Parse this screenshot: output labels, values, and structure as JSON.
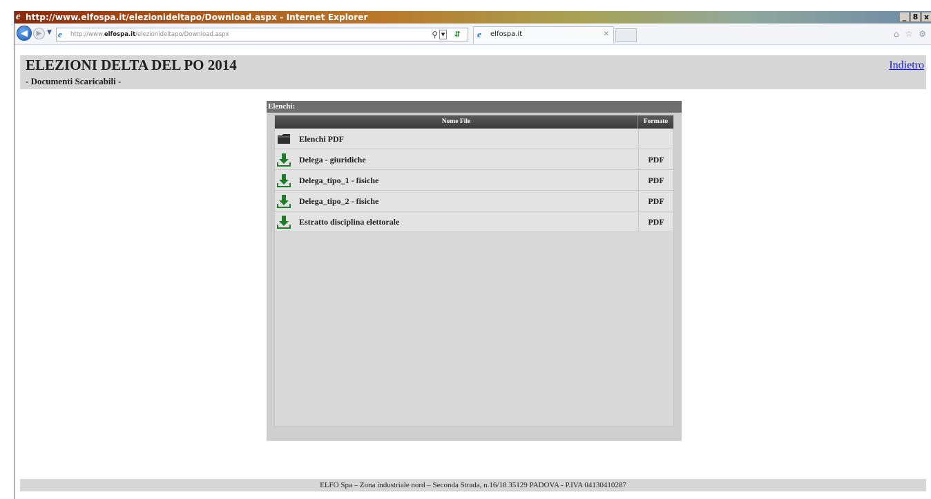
{
  "window": {
    "title": "http://www.elfospa.it/elezionideltapo/Download.aspx - Internet Explorer",
    "buttons": [
      "_",
      "8",
      "x"
    ]
  },
  "browser": {
    "url_prefix": "http://www.",
    "url_domain": "elfospa.it",
    "url_path": "/elezionideltapo/Download.aspx",
    "tab_label": "elfospa.it"
  },
  "header": {
    "title": "ELEZIONI DELTA DEL PO 2014",
    "subtitle": "- Documenti Scaricabili -",
    "back_link": "Indietro"
  },
  "panel": {
    "title": "Elenchi:",
    "columns": {
      "name": "Nome File",
      "format": "Formato"
    },
    "rows": [
      {
        "name": "Elenchi PDF",
        "format": "",
        "icon": "folder-icon"
      },
      {
        "name": "Delega - giuridiche",
        "format": "PDF",
        "icon": "download-icon"
      },
      {
        "name": "Delega_tipo_1 - fisiche",
        "format": "PDF",
        "icon": "download-icon"
      },
      {
        "name": "Delega_tipo_2 - fisiche",
        "format": "PDF",
        "icon": "download-icon"
      },
      {
        "name": "Estratto disciplina elettorale",
        "format": "PDF",
        "icon": "download-icon"
      }
    ]
  },
  "footer": {
    "text": "ELFO Spa – Zona industriale nord – Seconda Strada, n.16/18 35129 PADOVA - P.IVA 04130410287"
  },
  "colors": {
    "header_band": "#d6d6d6",
    "panel_head": "#6f6f6f",
    "grid_header": "#3b3b3b",
    "download_green": "#1f7a2a",
    "link": "#1a1ab0"
  }
}
